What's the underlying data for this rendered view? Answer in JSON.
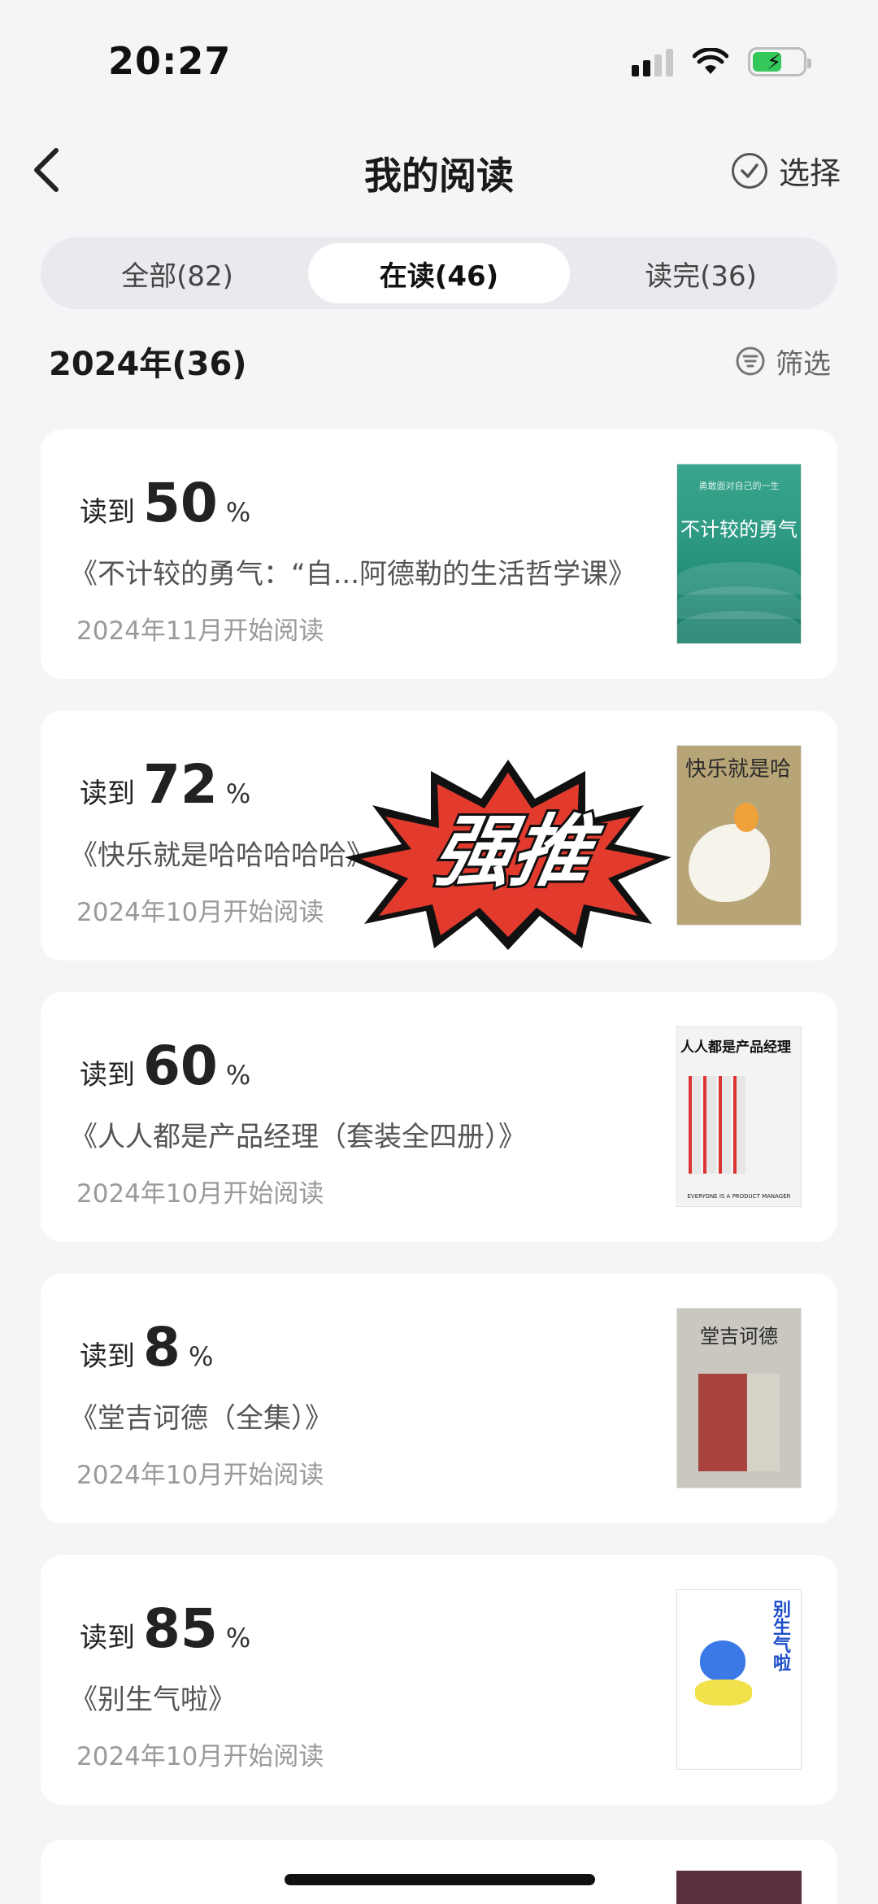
{
  "status_bar": {
    "time": "20:27"
  },
  "nav": {
    "title": "我的阅读",
    "select_label": "选择"
  },
  "tabs": [
    {
      "label": "全部(82)",
      "active": false
    },
    {
      "label": "在读(46)",
      "active": true
    },
    {
      "label": "读完(36)",
      "active": false
    }
  ],
  "section": {
    "year_label": "2024年(36)",
    "filter_label": "筛选"
  },
  "books": [
    {
      "progress_label": "读到",
      "percent": "50",
      "percent_sign": "%",
      "title": "《不计较的勇气：“自...阿德勒的生活哲学课》",
      "date": "2024年11月开始阅读",
      "cover_title": "不计较的勇气",
      "cover_subtitle": "勇敢面对自己的一生"
    },
    {
      "progress_label": "读到",
      "percent": "72",
      "percent_sign": "%",
      "title": "《快乐就是哈哈哈哈哈》",
      "date": "2024年10月开始阅读",
      "cover_title": "快乐就是哈"
    },
    {
      "progress_label": "读到",
      "percent": "60",
      "percent_sign": "%",
      "title": "《人人都是产品经理（套装全四册）》",
      "date": "2024年10月开始阅读",
      "cover_title": "人人都是产品经理",
      "cover_bottom": "EVERYONE IS A PRODUCT MANAGER"
    },
    {
      "progress_label": "读到",
      "percent": "8",
      "percent_sign": "%",
      "title": "《堂吉诃德（全集）》",
      "date": "2024年10月开始阅读",
      "cover_title": "堂吉诃德"
    },
    {
      "progress_label": "读到",
      "percent": "85",
      "percent_sign": "%",
      "title": "《别生气啦》",
      "date": "2024年10月开始阅读",
      "cover_title": "别生气啦"
    }
  ],
  "sticker": {
    "text": "强推",
    "fill": "#e23b2e"
  }
}
